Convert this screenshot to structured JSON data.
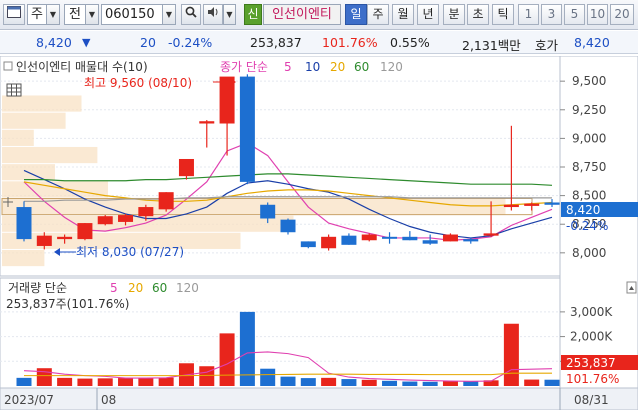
{
  "toolbar": {
    "market": "주",
    "search_kind": "전",
    "stock_code": "060150",
    "credit_badge": "신",
    "stock_name": "인선이엔티",
    "periods": [
      "일",
      "주",
      "월",
      "년",
      "분",
      "초",
      "틱"
    ],
    "active_period": "일",
    "intervals": [
      "1",
      "3",
      "5",
      "10",
      "20"
    ],
    "colors": {
      "active": "#3d6ec9",
      "credit": "#5aa02c",
      "name_text": "#c2185b"
    }
  },
  "quote": {
    "price": "8,420",
    "change_icon": "triangle-down-icon",
    "change": "20",
    "change_pct": "-0.24%",
    "volume": "253,837",
    "volume_ratio": "101.76%",
    "turnover": "0.55%",
    "amount": "2,131백만",
    "bid_label": "호가",
    "bid_price": "8,420"
  },
  "price_panel": {
    "title": "인선이엔티 매물대 수(10)",
    "ma_label": "종가 단순",
    "ma_periods": [
      "5",
      "10",
      "20",
      "60",
      "120"
    ],
    "ma_colors": {
      "5": "#e040b0",
      "10": "#1a3fa8",
      "20": "#e6a800",
      "60": "#2e8b2e",
      "120": "#9a9a9a"
    },
    "high_annotation": "최고 9,560 (08/10)",
    "low_annotation": "최저 8,030 (07/27)",
    "y_ticks": [
      "9,500",
      "9,250",
      "9,000",
      "8,750",
      "8,500",
      "8,250",
      "8,000"
    ],
    "current_price_tag": "8,420",
    "current_pct_tag": "-0.24%"
  },
  "volume_panel": {
    "title": "거래량 단순",
    "ma_periods": [
      "5",
      "20",
      "60",
      "120"
    ],
    "summary": "253,837주(101.76%)",
    "y_ticks": [
      "3,000K",
      "2,000K",
      "1,000K"
    ],
    "current_volume_tag": "253,837",
    "current_pct_tag": "101.76%"
  },
  "date_axis": {
    "start": "2023/07",
    "month_marker": "08",
    "end": "08/31"
  },
  "chart_data": {
    "type": "candlestick",
    "colors": {
      "up": "#e8251c",
      "down": "#1d6fd1"
    },
    "ylim": [
      7850,
      9650
    ],
    "volume_ylim": [
      0,
      3400
    ],
    "candles": [
      {
        "o": 8400,
        "h": 8450,
        "l": 8100,
        "c": 8120,
        "v": 330
      },
      {
        "o": 8060,
        "h": 8180,
        "l": 8030,
        "c": 8150,
        "v": 720
      },
      {
        "o": 8120,
        "h": 8160,
        "l": 8080,
        "c": 8140,
        "v": 330
      },
      {
        "o": 8120,
        "h": 8260,
        "l": 8110,
        "c": 8260,
        "v": 300
      },
      {
        "o": 8250,
        "h": 8330,
        "l": 8240,
        "c": 8320,
        "v": 310
      },
      {
        "o": 8270,
        "h": 8340,
        "l": 8240,
        "c": 8330,
        "v": 320
      },
      {
        "o": 8320,
        "h": 8420,
        "l": 8280,
        "c": 8400,
        "v": 330
      },
      {
        "o": 8380,
        "h": 8530,
        "l": 8360,
        "c": 8530,
        "v": 340
      },
      {
        "o": 8670,
        "h": 8820,
        "l": 8640,
        "c": 8820,
        "v": 920
      },
      {
        "o": 9130,
        "h": 9160,
        "l": 8920,
        "c": 9150,
        "v": 800
      },
      {
        "o": 9130,
        "h": 9330,
        "l": 8850,
        "c": 9540,
        "v": 2130
      },
      {
        "o": 9540,
        "h": 9560,
        "l": 8600,
        "c": 8620,
        "v": 3000
      },
      {
        "o": 8420,
        "h": 8440,
        "l": 8260,
        "c": 8300,
        "v": 700
      },
      {
        "o": 8290,
        "h": 8300,
        "l": 8160,
        "c": 8180,
        "v": 380
      },
      {
        "o": 8100,
        "h": 8100,
        "l": 8040,
        "c": 8050,
        "v": 320
      },
      {
        "o": 8040,
        "h": 8160,
        "l": 8020,
        "c": 8140,
        "v": 330
      },
      {
        "o": 8150,
        "h": 8170,
        "l": 8070,
        "c": 8070,
        "v": 280
      },
      {
        "o": 8110,
        "h": 8170,
        "l": 8100,
        "c": 8160,
        "v": 250
      },
      {
        "o": 8140,
        "h": 8180,
        "l": 8080,
        "c": 8130,
        "v": 210
      },
      {
        "o": 8140,
        "h": 8190,
        "l": 8110,
        "c": 8110,
        "v": 180
      },
      {
        "o": 8110,
        "h": 8160,
        "l": 8070,
        "c": 8080,
        "v": 170
      },
      {
        "o": 8100,
        "h": 8170,
        "l": 8100,
        "c": 8160,
        "v": 200
      },
      {
        "o": 8120,
        "h": 8130,
        "l": 8080,
        "c": 8100,
        "v": 190
      },
      {
        "o": 8150,
        "h": 8450,
        "l": 8140,
        "c": 8170,
        "v": 230
      },
      {
        "o": 8400,
        "h": 9110,
        "l": 8370,
        "c": 8420,
        "v": 2520
      },
      {
        "o": 8410,
        "h": 8440,
        "l": 8370,
        "c": 8430,
        "v": 260
      },
      {
        "o": 8440,
        "h": 8470,
        "l": 8400,
        "c": 8420,
        "v": 254
      }
    ],
    "ma_lines": {
      "5": [
        8620,
        8450,
        8310,
        8200,
        8190,
        8220,
        8260,
        8330,
        8470,
        8620,
        8890,
        8960,
        8850,
        8620,
        8400,
        8260,
        8210,
        8170,
        8130,
        8130,
        8130,
        8110,
        8120,
        8140,
        8240,
        8310,
        8380
      ],
      "10": [
        8720,
        8640,
        8560,
        8470,
        8400,
        8340,
        8300,
        8300,
        8340,
        8400,
        8520,
        8610,
        8630,
        8600,
        8560,
        8530,
        8470,
        8380,
        8300,
        8230,
        8180,
        8150,
        8130,
        8150,
        8210,
        8260,
        8310
      ],
      "20": [
        8620,
        8590,
        8560,
        8530,
        8500,
        8480,
        8460,
        8450,
        8450,
        8460,
        8490,
        8520,
        8540,
        8550,
        8550,
        8540,
        8520,
        8500,
        8480,
        8460,
        8440,
        8420,
        8410,
        8410,
        8420,
        8430,
        8440
      ],
      "60": [
        8640,
        8640,
        8630,
        8630,
        8630,
        8630,
        8640,
        8640,
        8650,
        8660,
        8670,
        8680,
        8690,
        8690,
        8680,
        8670,
        8660,
        8650,
        8640,
        8630,
        8620,
        8610,
        8600,
        8600,
        8600,
        8600,
        8590
      ],
      "120": [
        8450,
        8450,
        8460,
        8460,
        8460,
        8470,
        8470,
        8470,
        8480,
        8480,
        8490,
        8490,
        8490,
        8490,
        8490,
        8490,
        8490,
        8490,
        8490,
        8480,
        8480,
        8480,
        8480,
        8480,
        8480,
        8480,
        8480
      ]
    },
    "volume_ma5": [
      620,
      580,
      480,
      420,
      390,
      320,
      320,
      330,
      450,
      560,
      890,
      1340,
      1380,
      1310,
      1150,
      520,
      360,
      300,
      270,
      240,
      220,
      200,
      190,
      200,
      660,
      680,
      700
    ],
    "volume_ma20": [
      420,
      420,
      420,
      420,
      420,
      420,
      420,
      420,
      420,
      430,
      440,
      450,
      460,
      470,
      480,
      480,
      480,
      470,
      470,
      470,
      460,
      460,
      460,
      460,
      520,
      520,
      520
    ],
    "volume_profile": [
      {
        "price": 9300,
        "share": 0.15
      },
      {
        "price": 9150,
        "share": 0.12
      },
      {
        "price": 9000,
        "share": 0.06
      },
      {
        "price": 8850,
        "share": 0.18
      },
      {
        "price": 8700,
        "share": 0.1
      },
      {
        "price": 8550,
        "share": 0.2
      },
      {
        "price": 8400,
        "share": 0.95
      },
      {
        "price": 8250,
        "share": 0.55
      },
      {
        "price": 8100,
        "share": 0.45
      },
      {
        "price": 7950,
        "share": 0.08
      }
    ]
  }
}
